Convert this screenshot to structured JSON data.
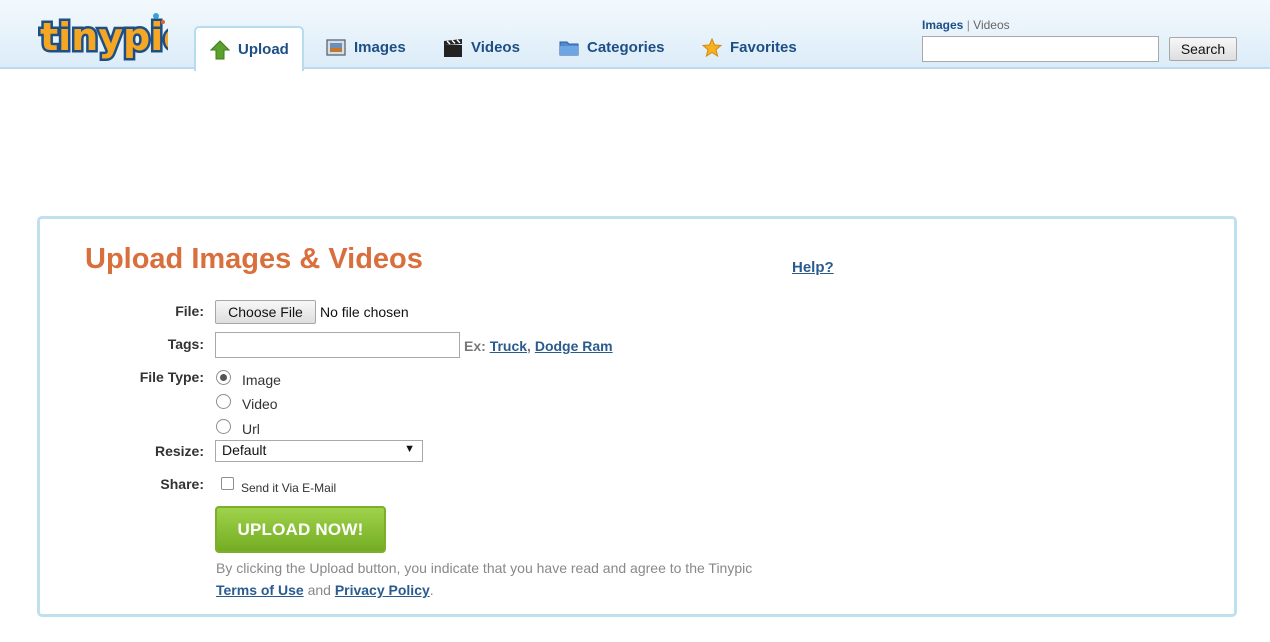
{
  "logo": {
    "text": "tinypic"
  },
  "nav": {
    "tabs": [
      {
        "label": "Upload",
        "icon": "upload-arrow-icon",
        "active": true
      },
      {
        "label": "Images",
        "icon": "images-icon",
        "active": false
      },
      {
        "label": "Videos",
        "icon": "clapperboard-icon",
        "active": false
      },
      {
        "label": "Categories",
        "icon": "folder-icon",
        "active": false
      },
      {
        "label": "Favorites",
        "icon": "star-icon",
        "active": false
      }
    ]
  },
  "search": {
    "scope_selected": "Images",
    "scope_separator": "|",
    "scope_other": "Videos",
    "value": "",
    "placeholder": "",
    "button_label": "Search"
  },
  "upload": {
    "title": "Upload Images & Videos",
    "help_label": "Help?",
    "file": {
      "label": "File:",
      "button_label": "Choose File",
      "status": "No file chosen"
    },
    "tags": {
      "label": "Tags:",
      "value": "",
      "example_prefix": "Ex:",
      "examples": [
        "Truck",
        "Dodge Ram"
      ],
      "example_separator": ","
    },
    "file_type": {
      "label": "File Type:",
      "options": [
        {
          "label": "Image",
          "checked": true
        },
        {
          "label": "Video",
          "checked": false
        },
        {
          "label": "Url",
          "checked": false
        }
      ]
    },
    "resize": {
      "label": "Resize:",
      "selected": "Default"
    },
    "share": {
      "label": "Share:",
      "checkbox_label": "Send it Via E-Mail",
      "checked": false
    },
    "submit_label": "UPLOAD NOW!",
    "disclaimer": {
      "text": "By clicking the Upload button, you indicate that you have read and agree to the Tinypic",
      "terms_label": "Terms of Use",
      "and_text": "and",
      "privacy_label": "Privacy Policy",
      "end": "."
    }
  },
  "colors": {
    "title_orange": "#d86f3c",
    "link_blue": "#2a5b8f",
    "nav_blue": "#1d4f86",
    "panel_border": "#bfe0ee",
    "upload_green": "#8cc43a"
  }
}
